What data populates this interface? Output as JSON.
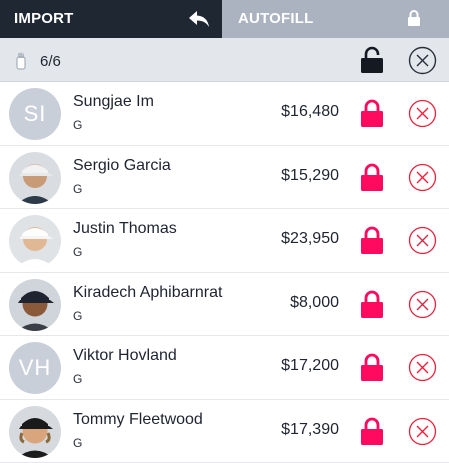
{
  "tabs": {
    "import_label": "IMPORT",
    "autofill_label": "AUTOFILL"
  },
  "subbar": {
    "slot_count": "6/6"
  },
  "players": [
    {
      "name": "Sungjae Im",
      "position": "G",
      "salary": "$16,480",
      "avatar_initials": "SI",
      "has_photo": false
    },
    {
      "name": "Sergio Garcia",
      "position": "G",
      "salary": "$15,290",
      "avatar_initials": "",
      "has_photo": true
    },
    {
      "name": "Justin Thomas",
      "position": "G",
      "salary": "$23,950",
      "avatar_initials": "",
      "has_photo": true
    },
    {
      "name": "Kiradech Aphibarnrat",
      "position": "G",
      "salary": "$8,000",
      "avatar_initials": "",
      "has_photo": true
    },
    {
      "name": "Viktor Hovland",
      "position": "G",
      "salary": "$17,200",
      "avatar_initials": "VH",
      "has_photo": false
    },
    {
      "name": "Tommy Fleetwood",
      "position": "G",
      "salary": "$17,390",
      "avatar_initials": "",
      "has_photo": true
    }
  ],
  "colors": {
    "tab_active_bg": "#1f2733",
    "tab_inactive_bg": "#aab3bf",
    "lock_accent": "#ff0a5e",
    "remove_accent": "#e8213b",
    "subbar_bg": "#e3e6eb",
    "avatar_bg": "#c9cfd9"
  },
  "icons": {
    "import_tab": "undo-arrow-icon",
    "autofill_tab": "lock-icon",
    "slots": "golf-bag-icon",
    "unlock_all": "unlocked-padlock-icon",
    "remove_all": "circle-x-icon",
    "row_lock": "padlock-icon",
    "row_remove": "circle-x-icon"
  }
}
